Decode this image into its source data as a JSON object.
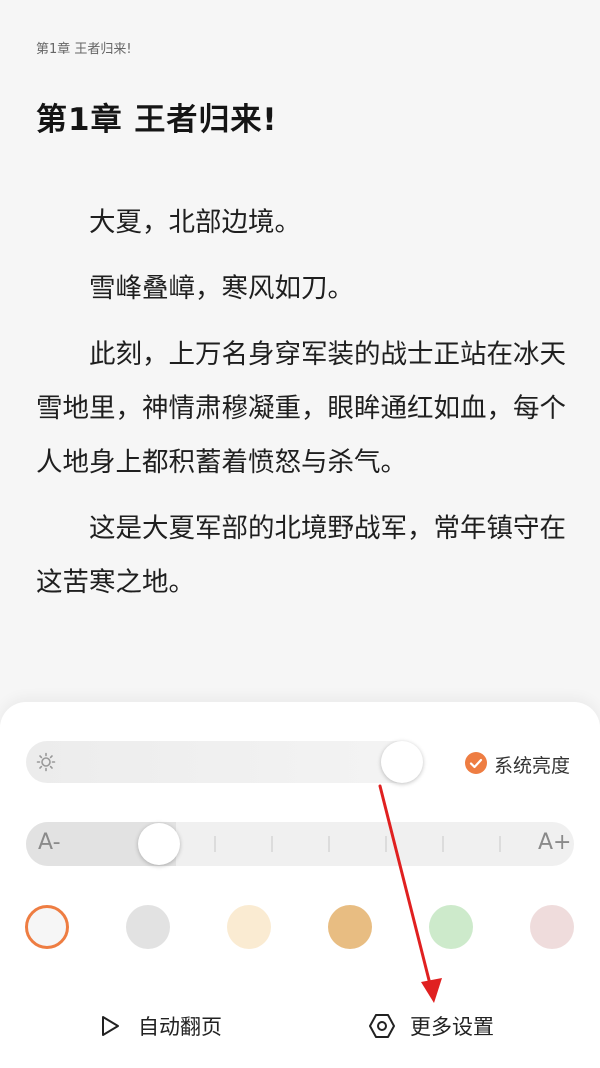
{
  "reader": {
    "running_header": "第1章 王者归来!",
    "chapter_title": "第1章 王者归来!",
    "paragraphs": [
      "大夏，北部边境。",
      "雪峰叠嶂，寒风如刀。",
      "此刻，上万名身穿军装的战士正站在冰天雪地里，神情肃穆凝重，眼眸通红如血，每个人地身上都积蓄着愤怒与杀气。",
      "这是大夏军部的北境野战军，常年镇守在这苦寒之地。"
    ]
  },
  "settings_panel": {
    "brightness": {
      "icon": "sun-icon",
      "level_fraction": 0.96,
      "system_brightness_label": "系统亮度",
      "system_brightness_checked": true
    },
    "font_size": {
      "decrease_label": "A-",
      "increase_label": "A+",
      "level_fraction": 0.24
    },
    "background_colors": [
      {
        "name": "white",
        "color": "#f6f6f6",
        "selected": true
      },
      {
        "name": "gray",
        "color": "#e2e2e2",
        "selected": false
      },
      {
        "name": "cream",
        "color": "#faebd2",
        "selected": false
      },
      {
        "name": "tan",
        "color": "#e8bd82",
        "selected": false
      },
      {
        "name": "green",
        "color": "#cdeacb",
        "selected": false
      },
      {
        "name": "pink",
        "color": "#efdcdc",
        "selected": false
      }
    ],
    "actions": {
      "auto_page_label": "自动翻页",
      "more_settings_label": "更多设置"
    }
  },
  "colors": {
    "accent": "#ee7d42",
    "annotation_arrow": "#e02020"
  }
}
